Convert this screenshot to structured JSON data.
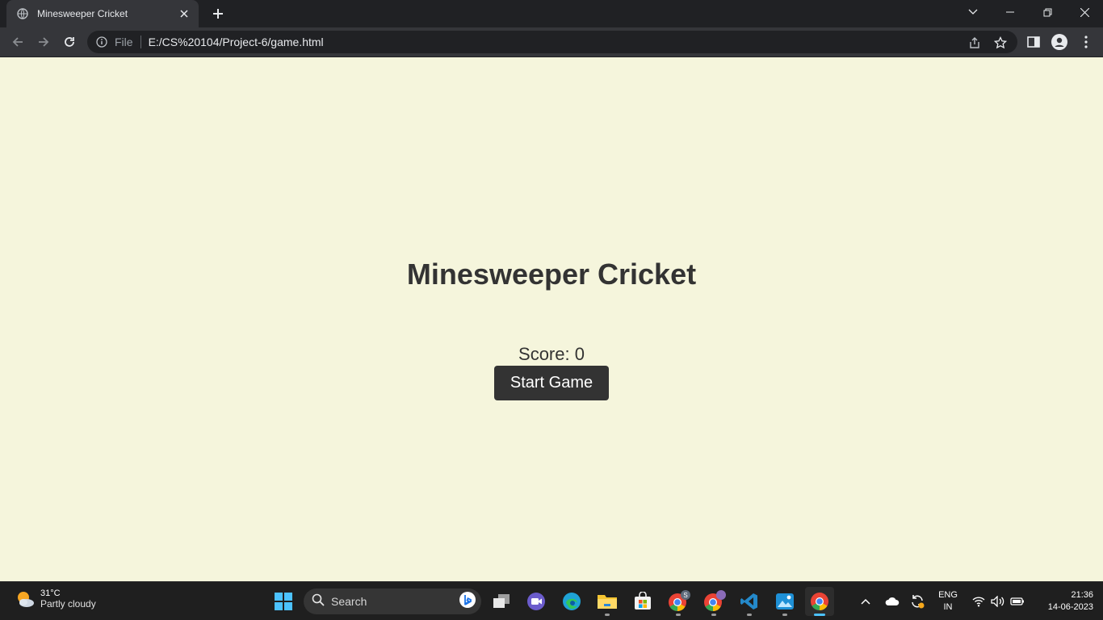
{
  "browser": {
    "tab_title": "Minesweeper Cricket",
    "url_scheme": "File",
    "url": "E:/CS%20104/Project-6/game.html"
  },
  "page": {
    "title": "Minesweeper Cricket",
    "score_label": "Score: ",
    "score_value": "0",
    "start_button": "Start Game",
    "background_color": "#f5f5dc",
    "text_color": "#333333"
  },
  "taskbar": {
    "weather_temp": "31°C",
    "weather_desc": "Partly cloudy",
    "search_label": "Search",
    "lang_line1": "ENG",
    "lang_line2": "IN",
    "time": "21:36",
    "date": "14-06-2023",
    "apps": [
      "start-icon",
      "search",
      "task-view-icon",
      "meet-icon",
      "edge-icon",
      "file-explorer-icon",
      "store-icon",
      "chrome-profile-s-icon",
      "chrome-profile-2-icon",
      "vscode-icon",
      "photos-icon",
      "chrome-icon"
    ]
  }
}
